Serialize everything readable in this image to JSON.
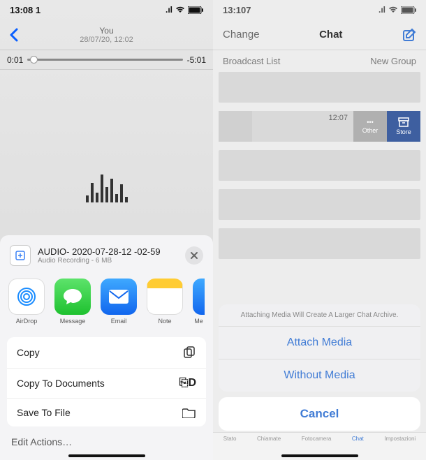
{
  "left": {
    "status_time": "13:08 1",
    "header": {
      "title": "You",
      "subtitle": "28/07/20, 12:02"
    },
    "scrub": {
      "elapsed": "0:01",
      "remaining": "-5:01"
    },
    "share": {
      "filename": "AUDIO- 2020-07-28-12 -02-59",
      "fileinfo": "Audio Recording - 6 MB",
      "apps": [
        {
          "name": "AirDrop"
        },
        {
          "name": "Message"
        },
        {
          "name": "Email"
        },
        {
          "name": "Note"
        },
        {
          "name": "Me"
        }
      ],
      "actions": {
        "copy": "Copy",
        "copy_docs": "Copy To Documents",
        "save_file": "Save To File"
      },
      "edit": "Edit Actions…"
    }
  },
  "right": {
    "status_time": "13:107",
    "header": {
      "left": "Change",
      "center": "Chat"
    },
    "sub": {
      "left": "Broadcast List",
      "right": "New Group"
    },
    "row_ts": "12:07",
    "swipe": {
      "other": "Other",
      "store": "Store"
    },
    "modal": {
      "hint": "Attaching Media Will Create A Larger Chat Archive.",
      "opt1": "Attach Media",
      "opt2": "Without Media",
      "cancel": "Cancel"
    },
    "tabs": [
      "Stato",
      "Chiamate",
      "Fotocamera",
      "Chat",
      "Impostazioni"
    ]
  }
}
